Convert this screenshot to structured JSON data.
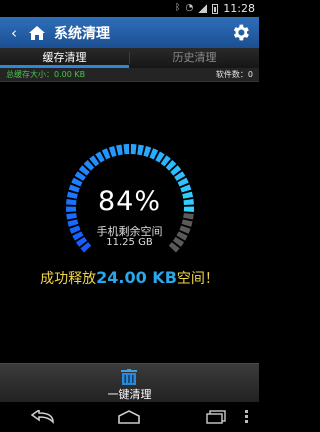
{
  "status_bar": {
    "time": "11:28"
  },
  "header": {
    "title": "系统清理"
  },
  "tabs": [
    {
      "label": "缓存清理",
      "active": true
    },
    {
      "label": "历史清理",
      "active": false
    }
  ],
  "info_bar": {
    "total_cache": "总缓存大小：0.00 KB",
    "software_count": "软件数：0"
  },
  "gauge": {
    "percent": "84%",
    "free_label": "手机剩余空间",
    "free_size": "11.25 GB",
    "level": 0.84
  },
  "release": {
    "prefix": "成功释放",
    "amount": "24.00 KB",
    "suffix": "空间！"
  },
  "clean_button": {
    "label": "一键清理"
  },
  "colors": {
    "accent": "#2d86d6",
    "header": "#2e6fb9",
    "success": "#47c54a",
    "highlight": "#f1d64a"
  }
}
